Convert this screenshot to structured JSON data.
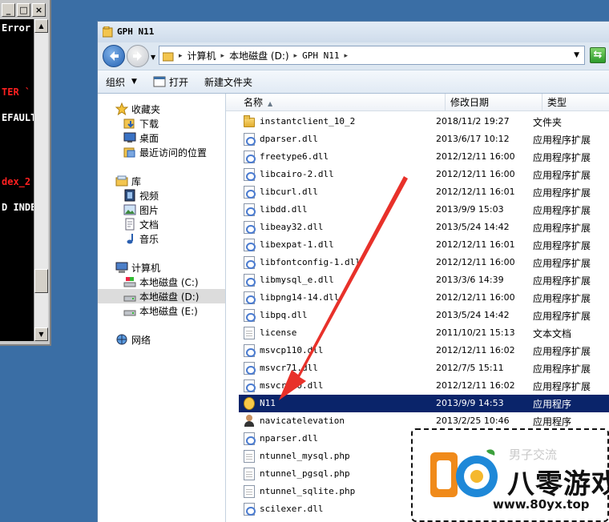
{
  "console": {
    "lines": [
      {
        "text": "Error",
        "color": "#ffffff"
      },
      {
        "text": "TER `",
        "color": "#ff2020"
      },
      {
        "text": "EFAULT",
        "color": "#ffffff"
      },
      {
        "text": "dex_2",
        "color": "#ff2020"
      },
      {
        "text": "D INDE",
        "color": "#ffffff"
      }
    ]
  },
  "window": {
    "title": "GPH N11"
  },
  "address": {
    "crumbs": [
      "计算机",
      "本地磁盘 (D:)",
      "GPH N11"
    ]
  },
  "toolbar": {
    "organize": "组织",
    "open": "打开",
    "new_folder": "新建文件夹"
  },
  "navpane": {
    "favorites": "收藏夹",
    "downloads": "下载",
    "desktop": "桌面",
    "recent": "最近访问的位置",
    "libraries": "库",
    "videos": "视频",
    "pictures": "图片",
    "documents": "文档",
    "music": "音乐",
    "computer": "计算机",
    "drive_c": "本地磁盘 (C:)",
    "drive_d": "本地磁盘 (D:)",
    "drive_e": "本地磁盘 (E:)",
    "network": "网络"
  },
  "columns": {
    "name": "名称",
    "date": "修改日期",
    "type": "类型"
  },
  "files": [
    {
      "name": "instantclient_10_2",
      "date": "2018/11/2 19:27",
      "type": "文件夹",
      "icon": "folder"
    },
    {
      "name": "dparser.dll",
      "date": "2013/6/17 10:12",
      "type": "应用程序扩展",
      "icon": "dll"
    },
    {
      "name": "freetype6.dll",
      "date": "2012/12/11 16:00",
      "type": "应用程序扩展",
      "icon": "dll"
    },
    {
      "name": "libcairo-2.dll",
      "date": "2012/12/11 16:00",
      "type": "应用程序扩展",
      "icon": "dll"
    },
    {
      "name": "libcurl.dll",
      "date": "2012/12/11 16:01",
      "type": "应用程序扩展",
      "icon": "dll"
    },
    {
      "name": "libdd.dll",
      "date": "2013/9/9 15:03",
      "type": "应用程序扩展",
      "icon": "dll"
    },
    {
      "name": "libeay32.dll",
      "date": "2013/5/24 14:42",
      "type": "应用程序扩展",
      "icon": "dll"
    },
    {
      "name": "libexpat-1.dll",
      "date": "2012/12/11 16:01",
      "type": "应用程序扩展",
      "icon": "dll"
    },
    {
      "name": "libfontconfig-1.dll",
      "date": "2012/12/11 16:00",
      "type": "应用程序扩展",
      "icon": "dll"
    },
    {
      "name": "libmysql_e.dll",
      "date": "2013/3/6 14:39",
      "type": "应用程序扩展",
      "icon": "dll"
    },
    {
      "name": "libpng14-14.dll",
      "date": "2012/12/11 16:00",
      "type": "应用程序扩展",
      "icon": "dll"
    },
    {
      "name": "libpq.dll",
      "date": "2013/5/24 14:42",
      "type": "应用程序扩展",
      "icon": "dll"
    },
    {
      "name": "license",
      "date": "2011/10/21 15:13",
      "type": "文本文档",
      "icon": "doc"
    },
    {
      "name": "msvcp110.dll",
      "date": "2012/12/11 16:02",
      "type": "应用程序扩展",
      "icon": "dll"
    },
    {
      "name": "msvcr71.dll",
      "date": "2012/7/5 15:11",
      "type": "应用程序扩展",
      "icon": "dll"
    },
    {
      "name": "msvcr110.dll",
      "date": "2012/12/11 16:02",
      "type": "应用程序扩展",
      "icon": "dll"
    },
    {
      "name": "N11",
      "date": "2013/9/9 14:53",
      "type": "应用程序",
      "icon": "exe",
      "selected": true
    },
    {
      "name": "navicatelevation",
      "date": "2013/2/25 10:46",
      "type": "应用程序",
      "icon": "person"
    },
    {
      "name": "nparser.dll",
      "date": "",
      "type": "",
      "icon": "dll"
    },
    {
      "name": "ntunnel_mysql.php",
      "date": "",
      "type": "",
      "icon": "doc"
    },
    {
      "name": "ntunnel_pgsql.php",
      "date": "",
      "type": "",
      "icon": "doc"
    },
    {
      "name": "ntunnel_sqlite.php",
      "date": "",
      "type": "",
      "icon": "doc"
    },
    {
      "name": "scilexer.dll",
      "date": "",
      "type": "",
      "icon": "dll"
    }
  ],
  "watermark": {
    "brand": "八零游戏",
    "url": "www.80yx.top",
    "faint_text": "男子交流"
  },
  "colors": {
    "selection": "#0a246a",
    "arrow": "#e8312a",
    "desktop": "#3a6ea5"
  }
}
